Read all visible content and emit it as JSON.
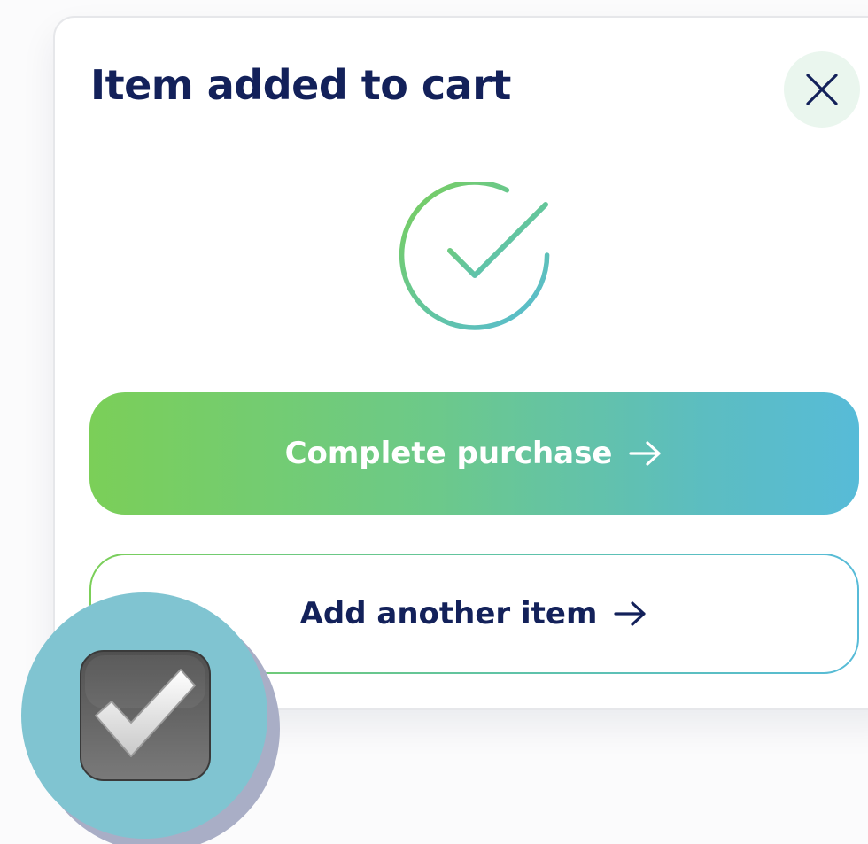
{
  "dialog": {
    "title": "Item added to cart",
    "close_icon": "close-icon",
    "status_icon": "checkmark-circle-icon",
    "primary_action": {
      "label": "Complete purchase",
      "icon": "arrow-right-icon"
    },
    "secondary_action": {
      "label": "Add another item",
      "icon": "arrow-right-icon"
    }
  },
  "overlay_badge": {
    "icon": "checkbox-checked-icon"
  },
  "colors": {
    "title": "#13215a",
    "close_bg": "#eaf6ee",
    "gradient_start": "#7bcf58",
    "gradient_end": "#57bbd8",
    "badge": "#80c4d1",
    "badge_shadow": "#a9aec6"
  }
}
